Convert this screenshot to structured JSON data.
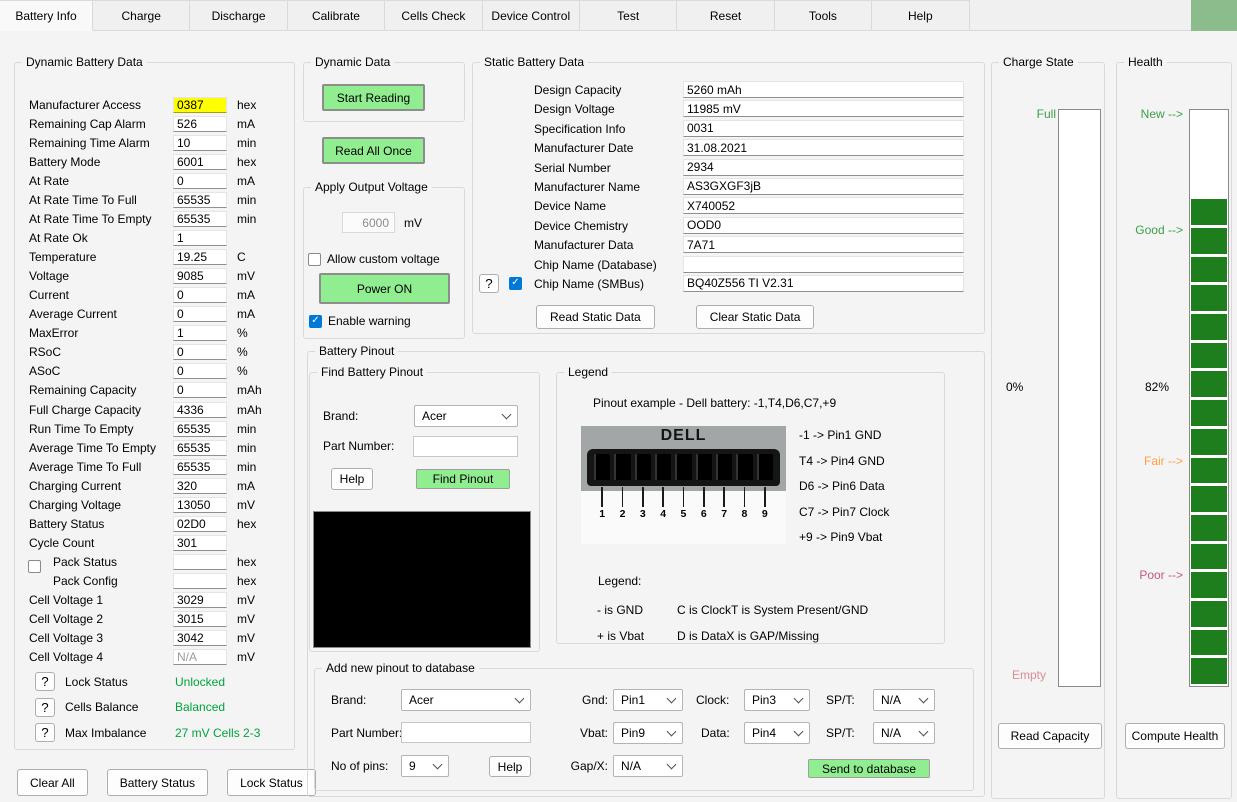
{
  "colors": {
    "accent_green": "#90EE90",
    "health_green": "#1e7e1e",
    "tab_corner_green": "#8cbb8c",
    "status_green": "#00a33e",
    "label_green": "#3ca04a",
    "warn_orange": "#ffa040",
    "poor_red": "#c25b78",
    "empty_red": "#d98d97",
    "highlight_yellow": "#ffff00",
    "check_blue": "#0078d7"
  },
  "tabs": [
    {
      "label": "Battery Info",
      "active": true
    },
    {
      "label": "Charge"
    },
    {
      "label": "Discharge"
    },
    {
      "label": "Calibrate"
    },
    {
      "label": "Cells Check"
    },
    {
      "label": "Device Control"
    },
    {
      "label": "Test"
    },
    {
      "label": "Reset"
    },
    {
      "label": "Tools"
    },
    {
      "label": "Help"
    }
  ],
  "dynamic_battery_data": {
    "title": "Dynamic Battery Data",
    "rows": [
      {
        "label": "Manufacturer Access",
        "value": "0387",
        "unit": "hex",
        "highlight": true
      },
      {
        "label": "Remaining Cap Alarm",
        "value": "526",
        "unit": "mA"
      },
      {
        "label": "Remaining Time Alarm",
        "value": "10",
        "unit": "min"
      },
      {
        "label": "Battery Mode",
        "value": "6001",
        "unit": "hex"
      },
      {
        "label": "At Rate",
        "value": "0",
        "unit": "mA"
      },
      {
        "label": "At Rate Time To Full",
        "value": "65535",
        "unit": "min"
      },
      {
        "label": "At Rate Time To Empty",
        "value": "65535",
        "unit": "min"
      },
      {
        "label": "At Rate Ok",
        "value": "1",
        "unit": ""
      },
      {
        "label": "Temperature",
        "value": "19.25",
        "unit": "C"
      },
      {
        "label": "Voltage",
        "value": "9085",
        "unit": "mV"
      },
      {
        "label": "Current",
        "value": "0",
        "unit": "mA"
      },
      {
        "label": "Average Current",
        "value": "0",
        "unit": "mA"
      },
      {
        "label": "MaxError",
        "value": "1",
        "unit": "%"
      },
      {
        "label": "RSoC",
        "value": "0",
        "unit": "%"
      },
      {
        "label": "ASoC",
        "value": "0",
        "unit": "%"
      },
      {
        "label": "Remaining Capacity",
        "value": "0",
        "unit": "mAh"
      },
      {
        "label": "Full Charge Capacity",
        "value": "4336",
        "unit": "mAh"
      },
      {
        "label": "Run Time To Empty",
        "value": "65535",
        "unit": "min"
      },
      {
        "label": "Average Time To Empty",
        "value": "65535",
        "unit": "min"
      },
      {
        "label": "Average Time To Full",
        "value": "65535",
        "unit": "min"
      },
      {
        "label": "Charging Current",
        "value": "320",
        "unit": "mA"
      },
      {
        "label": "Charging Voltage",
        "value": "13050",
        "unit": "mV"
      },
      {
        "label": "Battery Status",
        "value": "02D0",
        "unit": "hex"
      },
      {
        "label": "Cycle Count",
        "value": "301",
        "unit": ""
      },
      {
        "label": "Pack Status",
        "value": "",
        "unit": "hex",
        "pack_checkbox": "top"
      },
      {
        "label": "Pack Config",
        "value": "",
        "unit": "hex",
        "pack_checkbox": "bottom"
      },
      {
        "label": "Cell Voltage 1",
        "value": "3029",
        "unit": "mV"
      },
      {
        "label": "Cell Voltage 2",
        "value": "3015",
        "unit": "mV"
      },
      {
        "label": "Cell Voltage 3",
        "value": "3042",
        "unit": "mV"
      },
      {
        "label": "Cell Voltage 4",
        "value": "N/A",
        "unit": "mV",
        "muted": true
      }
    ],
    "status_rows": [
      {
        "button": "?",
        "label": "Lock Status",
        "value": "Unlocked"
      },
      {
        "button": "?",
        "label": "Cells Balance",
        "value": "Balanced"
      },
      {
        "button": "?",
        "label": "Max Imbalance",
        "value": "27 mV Cells 2-3"
      }
    ]
  },
  "footer_buttons": [
    {
      "label": "Clear All"
    },
    {
      "label": "Battery Status"
    },
    {
      "label": "Lock Status"
    }
  ],
  "dynamic_data": {
    "title": "Dynamic Data",
    "start_reading": "Start Reading",
    "read_all_once": "Read All Once"
  },
  "apply_output_voltage": {
    "title": "Apply Output Voltage",
    "voltage_value": "6000",
    "voltage_unit": "mV",
    "allow_custom": "Allow custom voltage",
    "power_on": "Power ON",
    "enable_warning": "Enable warning"
  },
  "static_battery_data": {
    "title": "Static Battery Data",
    "rows": [
      {
        "label": "Design Capacity",
        "value": "5260 mAh"
      },
      {
        "label": "Design Voltage",
        "value": "11985 mV"
      },
      {
        "label": "Specification Info",
        "value": "0031"
      },
      {
        "label": "Manufacturer Date",
        "value": "31.08.2021"
      },
      {
        "label": "Serial Number",
        "value": "2934"
      },
      {
        "label": "Manufacturer Name",
        "value": "AS3GXGF3jB"
      },
      {
        "label": "Device Name",
        "value": "X740052"
      },
      {
        "label": "Device Chemistry",
        "value": "OOD0"
      },
      {
        "label": "Manufacturer Data",
        "value": "7A71"
      },
      {
        "label": "Chip Name (Database)",
        "value": ""
      },
      {
        "label": "Chip Name (SMBus)",
        "value": "BQ40Z556 TI V2.31",
        "help_button": "?",
        "checked": true
      }
    ],
    "buttons": [
      {
        "label": "Read Static Data"
      },
      {
        "label": "Clear Static Data"
      }
    ]
  },
  "battery_pinout": {
    "title": "Battery Pinout",
    "find": {
      "title": "Find Battery Pinout",
      "brand_label": "Brand:",
      "brand_value": "Acer",
      "part_label": "Part Number:",
      "part_value": "",
      "help": "Help",
      "find_pinout": "Find Pinout"
    },
    "legend": {
      "title": "Legend",
      "example_title": "Pinout example - Dell battery:  -1,T4,D6,C7,+9",
      "connector_brand": "DELL",
      "pin_numbers": [
        "1",
        "2",
        "3",
        "4",
        "5",
        "6",
        "7",
        "8",
        "9"
      ],
      "pin_mappings": [
        "-1 -> Pin1 GND",
        "T4 -> Pin4 GND",
        "D6 -> Pin6 Data",
        "C7 -> Pin7 Clock",
        "+9 -> Pin9 Vbat"
      ],
      "legend_label": "Legend:",
      "legend_rows": [
        [
          "- is GND",
          "C is Clock",
          "T is System Present/GND"
        ],
        [
          "+ is Vbat",
          "D is Data",
          "X is GAP/Missing"
        ]
      ]
    },
    "add": {
      "title": "Add new pinout to database",
      "brand_label": "Brand:",
      "brand_value": "Acer",
      "part_label": "Part Number:",
      "part_value": "",
      "pins_label": "No of pins:",
      "pins_value": "9",
      "help": "Help",
      "gnd_label": "Gnd:",
      "gnd_value": "Pin1",
      "vbat_label": "Vbat:",
      "vbat_value": "Pin9",
      "gapx_label": "Gap/X:",
      "gapx_value": "N/A",
      "clock_label": "Clock:",
      "clock_value": "Pin3",
      "data_label": "Data:",
      "data_value": "Pin4",
      "spt1_label": "SP/T:",
      "spt1_value": "N/A",
      "spt2_label": "SP/T:",
      "spt2_value": "N/A",
      "send": "Send to database"
    }
  },
  "charge_state": {
    "title": "Charge State",
    "full": "Full",
    "percent": "0%",
    "empty": "Empty",
    "button": "Read Capacity"
  },
  "health": {
    "title": "Health",
    "new": "New -->",
    "good": "Good -->",
    "percent": "82%",
    "fair": "Fair -->",
    "poor": "Poor -->",
    "segments": 17,
    "button": "Compute Health"
  }
}
